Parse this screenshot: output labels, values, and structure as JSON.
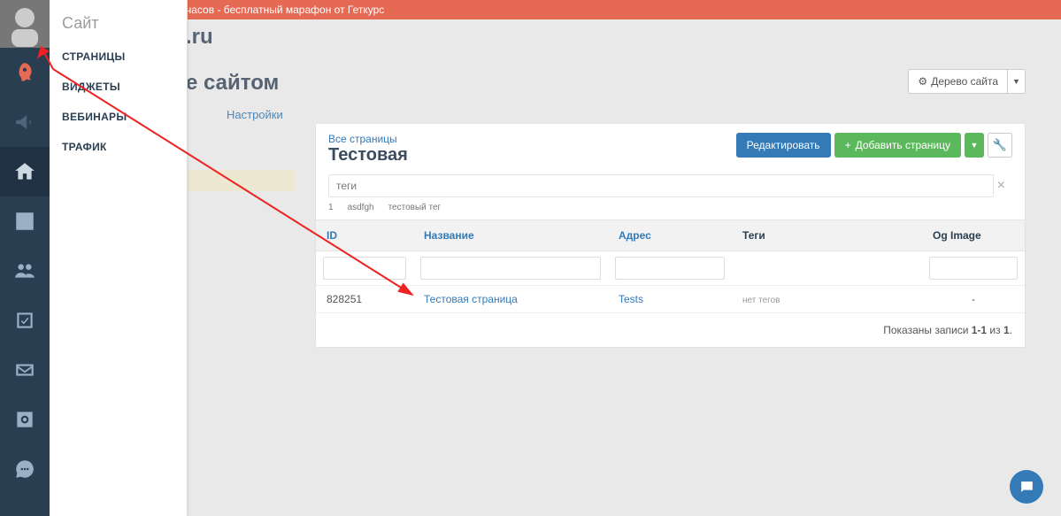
{
  "banner": "часов - бесплатный марафон от Геткурс",
  "brand_suffix": ".ru",
  "page_title": "е сайтом",
  "tabs": {
    "settings": "Настройки"
  },
  "submenu": {
    "title": "Сайт",
    "items": [
      "СТРАНИЦЫ",
      "ВИДЖЕТЫ",
      "ВЕБИНАРЫ",
      "ТРАФИК"
    ]
  },
  "tree_button": "Дерево сайта",
  "panel": {
    "breadcrumb": "Все страницы",
    "title": "Тестовая",
    "edit": "Редактировать",
    "add": "Добавить страницу",
    "tags_placeholder": "теги",
    "chips": [
      "1",
      "asdfgh",
      "тестовый тег"
    ]
  },
  "columns": {
    "id": "ID",
    "name": "Название",
    "addr": "Адрес",
    "tags": "Теги",
    "og": "Og Image"
  },
  "row": {
    "id": "828251",
    "name": "Тестовая страница",
    "addr": "Tests",
    "tags": "нет тегов",
    "og": "-"
  },
  "records": {
    "prefix": "Показаны записи ",
    "range": "1-1",
    "mid": " из ",
    "total": "1"
  }
}
